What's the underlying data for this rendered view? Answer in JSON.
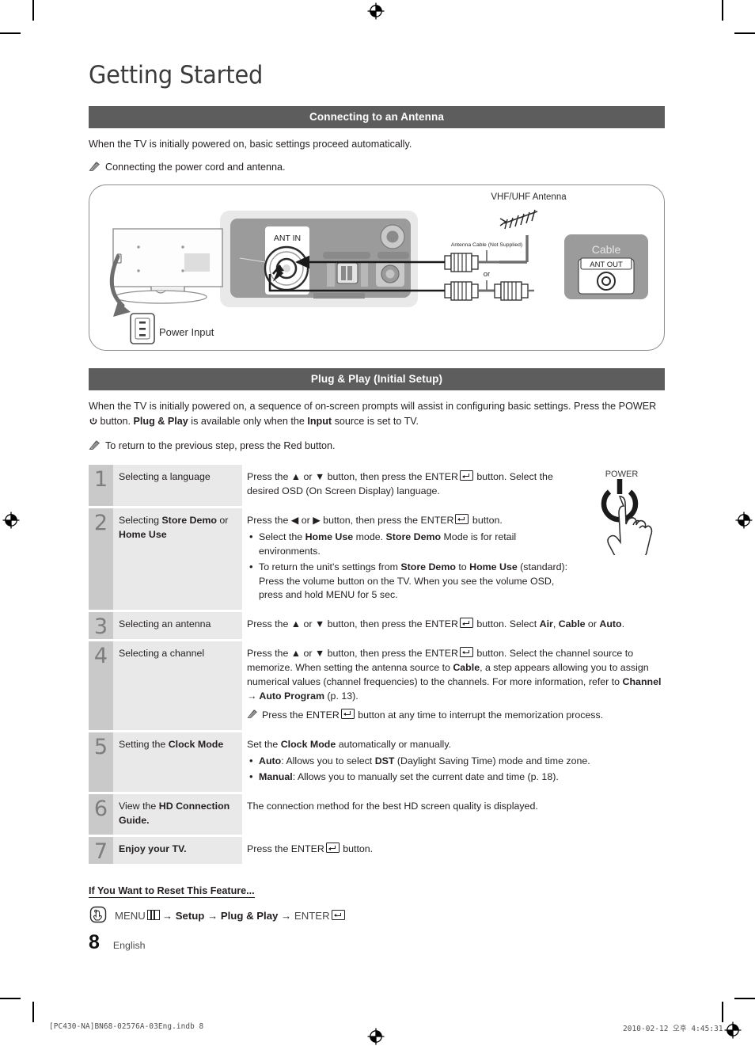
{
  "page": {
    "title": "Getting Started",
    "page_number": "8",
    "language": "English"
  },
  "sections": {
    "antenna": {
      "band": "Connecting to an Antenna",
      "intro": "When the TV is initially powered on, basic settings proceed automatically.",
      "note": "Connecting the power cord and antenna."
    },
    "plugplay": {
      "band": "Plug & Play (Initial Setup)",
      "intro_a": "When the TV is initially powered on, a sequence of on-screen prompts will assist in configuring basic settings. Press the POWER",
      "intro_b": " button. ",
      "intro_bold1": "Plug & Play",
      "intro_c": " is available only when the ",
      "intro_bold2": "Input",
      "intro_d": " source is set to TV.",
      "note": "To return to the previous step, press the Red button."
    }
  },
  "diagram": {
    "labels": {
      "ant_in": "ANT IN",
      "power_input": "Power Input",
      "vhf_uhf": "VHF/UHF Antenna",
      "antenna_cable": "Antenna Cable (Not Supplied)",
      "or": "or",
      "cable": "Cable",
      "ant_out": "ANT OUT"
    }
  },
  "steps": [
    {
      "num": "1",
      "title_parts": [
        {
          "t": "Selecting a language",
          "b": false
        }
      ],
      "desc_parts": [
        {
          "t": "Press the ",
          "b": false
        },
        {
          "t": "▲",
          "b": false
        },
        {
          "t": " or ",
          "b": false
        },
        {
          "t": "▼",
          "b": false
        },
        {
          "t": " button, then press the ENTER",
          "b": false
        },
        {
          "icon": "enter"
        },
        {
          "t": " button. Select the desired OSD (On Screen Display) language.",
          "b": false
        }
      ],
      "has_figure": true,
      "figure_label": "POWER"
    },
    {
      "num": "2",
      "title_parts": [
        {
          "t": "Selecting ",
          "b": false
        },
        {
          "t": "Store Demo",
          "b": true
        },
        {
          "t": " or ",
          "b": false
        },
        {
          "t": "Home Use",
          "b": true
        }
      ],
      "desc_lead": "Press the ◀ or ▶ button, then press the ENTER",
      "desc_lead_tail": " button.",
      "bullets": [
        [
          {
            "t": "Select the ",
            "b": false
          },
          {
            "t": "Home Use",
            "b": true
          },
          {
            "t": " mode. ",
            "b": false
          },
          {
            "t": "Store Demo",
            "b": true
          },
          {
            "t": " Mode is for retail environments.",
            "b": false
          }
        ],
        [
          {
            "t": "To return the unit's settings from ",
            "b": false
          },
          {
            "t": "Store Demo",
            "b": true
          },
          {
            "t": " to ",
            "b": false
          },
          {
            "t": "Home Use",
            "b": true
          },
          {
            "t": " (standard): Press the volume button on the TV. When you see the volume OSD, press and hold MENU for 5 sec.",
            "b": false
          }
        ]
      ]
    },
    {
      "num": "3",
      "title_parts": [
        {
          "t": "Selecting an antenna",
          "b": false
        }
      ],
      "desc_lead": "Press the ▲ or ▼ button, then press the ENTER",
      "desc_tail_parts": [
        {
          "t": " button. Select ",
          "b": false
        },
        {
          "t": "Air",
          "b": true
        },
        {
          "t": ", ",
          "b": false
        },
        {
          "t": "Cable",
          "b": true
        },
        {
          "t": " or ",
          "b": false
        },
        {
          "t": "Auto",
          "b": true
        },
        {
          "t": ".",
          "b": false
        }
      ]
    },
    {
      "num": "4",
      "title_parts": [
        {
          "t": "Selecting a channel",
          "b": false
        }
      ],
      "desc_lead": "Press the ▲ or ▼ button, then press the ENTER",
      "desc_tail_parts": [
        {
          "t": " button. Select the channel source to memorize. When setting the antenna source to ",
          "b": false
        },
        {
          "t": "Cable",
          "b": true
        },
        {
          "t": ", a step appears allowing you to assign numerical values (channel frequencies) to the channels. For more information, refer to ",
          "b": false
        },
        {
          "t": "Channel → Auto Program",
          "b": true
        },
        {
          "t": " (p. 13).",
          "b": false
        }
      ],
      "subnote_lead": "Press the ENTER",
      "subnote_tail": " button at any time to interrupt the memorization process."
    },
    {
      "num": "5",
      "title_parts": [
        {
          "t": "Setting the ",
          "b": false
        },
        {
          "t": "Clock Mode",
          "b": true
        }
      ],
      "desc_lead_parts": [
        {
          "t": "Set the ",
          "b": false
        },
        {
          "t": "Clock Mode",
          "b": true
        },
        {
          "t": " automatically or manually.",
          "b": false
        }
      ],
      "bullets": [
        [
          {
            "t": "Auto",
            "b": true
          },
          {
            "t": ": Allows you to select ",
            "b": false
          },
          {
            "t": "DST",
            "b": true
          },
          {
            "t": " (Daylight Saving Time) mode and time zone.",
            "b": false
          }
        ],
        [
          {
            "t": "Manual",
            "b": true
          },
          {
            "t": ": Allows you to manually set the current date and time (p. 18).",
            "b": false
          }
        ]
      ]
    },
    {
      "num": "6",
      "title_parts": [
        {
          "t": "View the ",
          "b": false
        },
        {
          "t": "HD Connection Guide.",
          "b": true
        }
      ],
      "desc_parts": [
        {
          "t": "The connection method for the best HD screen quality is displayed.",
          "b": false
        }
      ]
    },
    {
      "num": "7",
      "title_parts": [
        {
          "t": "Enjoy your TV.",
          "b": true
        }
      ],
      "desc_lead": "Press the ENTER",
      "desc_tail_parts": [
        {
          "t": " button.",
          "b": false
        }
      ]
    }
  ],
  "reset": {
    "heading": "If You Want to Reset This Feature...",
    "menu": "MENU",
    "path1": "→ Setup → Plug & Play → ",
    "enter": "ENTER"
  },
  "print_footer": {
    "left": "[PC430-NA]BN68-02576A-03Eng.indb   8",
    "right": "2010-02-12   오후 4:45:31"
  },
  "colors": {
    "band_bg": "#5d5d5d",
    "num_col_bg": "#c9c9c9",
    "title_col_bg": "#e9e9e9",
    "text": "#231f20"
  }
}
